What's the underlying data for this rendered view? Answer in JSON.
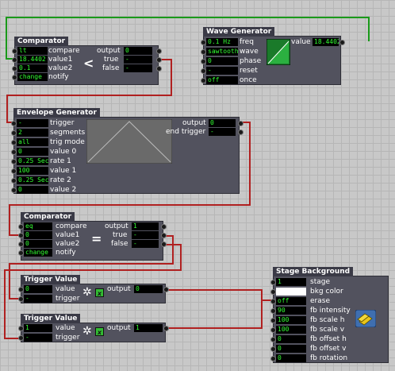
{
  "comparator1": {
    "title": "Comparator",
    "compare": "lt",
    "value1": "18.4402",
    "value2": "0.1",
    "notify": "change",
    "l_compare": "compare",
    "l_value1": "value1",
    "l_value2": "value2",
    "l_notify": "notify",
    "symbol": "<",
    "l_output": "output",
    "output": "0",
    "l_true": "true",
    "true_val": "-",
    "l_false": "false",
    "false_val": "-"
  },
  "wave": {
    "title": "Wave Generator",
    "freq": "0.1 Hz",
    "wave": "sawtooth",
    "phase": "0",
    "reset": "-",
    "once": "off",
    "l_freq": "freq",
    "l_wave": "wave",
    "l_phase": "phase",
    "l_reset": "reset",
    "l_once": "once",
    "l_value": "value",
    "value": "18.4402"
  },
  "env": {
    "title": "Envelope Generator",
    "rows": [
      {
        "val": "-",
        "label": "trigger"
      },
      {
        "val": "2",
        "label": "segments"
      },
      {
        "val": "all",
        "label": "trig mode"
      },
      {
        "val": "0",
        "label": "value 0"
      },
      {
        "val": "0.25 Seco",
        "label": "rate 1"
      },
      {
        "val": "100",
        "label": "value 1"
      },
      {
        "val": "0.25 Seco",
        "label": "rate 2"
      },
      {
        "val": "0",
        "label": "value 2"
      }
    ],
    "l_output": "output",
    "output": "0",
    "l_endtrig": "end trigger",
    "endtrig": "-"
  },
  "comparator2": {
    "title": "Comparator",
    "compare": "eq",
    "value1": "0",
    "value2": "0",
    "notify": "change",
    "l_compare": "compare",
    "l_value1": "value1",
    "l_value2": "value2",
    "l_notify": "notify",
    "symbol": "=",
    "l_output": "output",
    "output": "1",
    "l_true": "true",
    "true_val": "-",
    "l_false": "false",
    "false_val": "-"
  },
  "tv1": {
    "title": "Trigger Value",
    "value": "0",
    "trigger": "-",
    "l_value": "value",
    "l_trigger": "trigger",
    "l_output": "output",
    "output": "0"
  },
  "tv2": {
    "title": "Trigger Value",
    "value": "1",
    "trigger": "-",
    "l_value": "value",
    "l_trigger": "trigger",
    "l_output": "output",
    "output": "1"
  },
  "stage": {
    "title": "Stage Background",
    "rows": [
      {
        "val": "1",
        "label": "stage"
      },
      {
        "val": "",
        "label": "bkg color",
        "white": true
      },
      {
        "val": "off",
        "label": "erase"
      },
      {
        "val": "90",
        "label": "fb intensity"
      },
      {
        "val": "100",
        "label": "fb scale h"
      },
      {
        "val": "100",
        "label": "fb scale v"
      },
      {
        "val": "0",
        "label": "fb offset h"
      },
      {
        "val": "0",
        "label": "fb offset v"
      },
      {
        "val": "0",
        "label": "fb rotation"
      }
    ]
  },
  "colors": {
    "green_wire": "#1a9a1a",
    "red_wire": "#b02020",
    "field_text": "#33ff33",
    "actor_bg": "#52525e"
  }
}
